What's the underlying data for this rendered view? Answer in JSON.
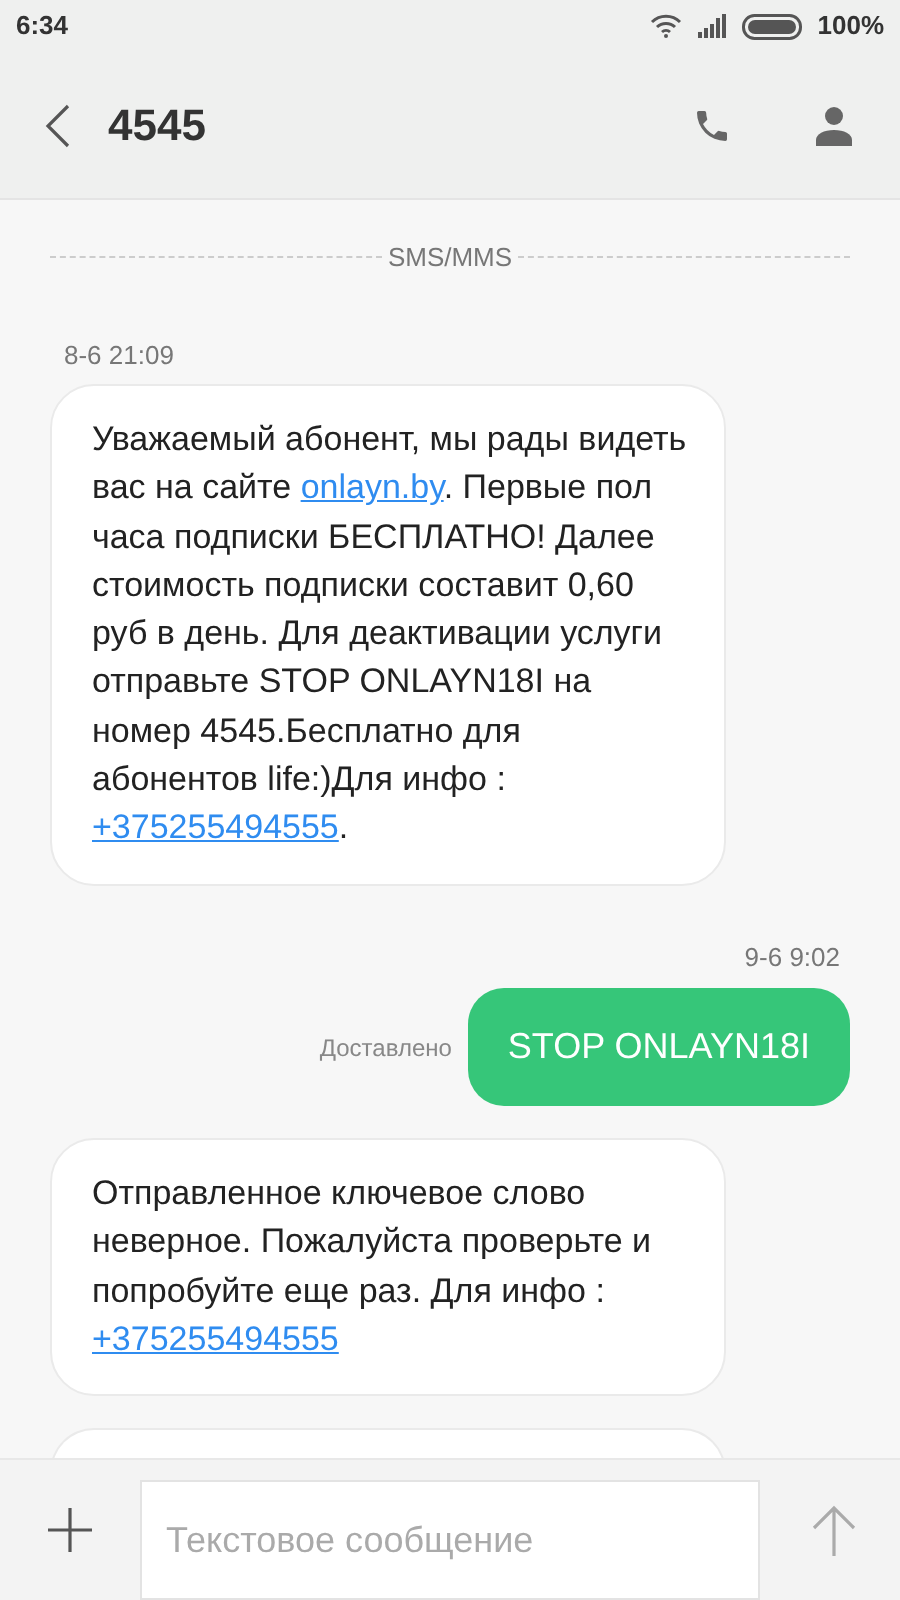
{
  "status_bar": {
    "time": "6:34",
    "battery": "100%"
  },
  "header": {
    "title": "4545"
  },
  "channel_label": "SMS/MMS",
  "messages": [
    {
      "kind": "received",
      "time": "8-6 21:09",
      "segments": [
        {
          "text": "Уважаемый абонент, мы рады видеть вас на сайте ",
          "link": false
        },
        {
          "text": "onlayn.by",
          "link": true
        },
        {
          "text": ". Первые пол часа подписки БЕСПЛАТНО! Далее стоимость подписки составит 0,60 руб в день. Для деактивации услуги отправьте STOP ONLAYN18I на номер 4545.Бесплатно для абонентов life:)Для инфо : ",
          "link": false
        },
        {
          "text": "+375255494555",
          "link": true
        },
        {
          "text": ".",
          "link": false
        }
      ]
    },
    {
      "kind": "sent",
      "time": "9-6 9:02",
      "status": "Доставлено",
      "segments": [
        {
          "text": "STOP ONLAYN18I",
          "link": false
        }
      ]
    },
    {
      "kind": "received",
      "segments": [
        {
          "text": "Отправленное ключевое слово неверное. Пожалуйста проверьте и попробуйте еще раз. Для инфо : ",
          "link": false
        },
        {
          "text": "+375255494555",
          "link": true
        }
      ]
    },
    {
      "kind": "partial"
    }
  ],
  "composer": {
    "placeholder": "Текстовое сообщение"
  }
}
